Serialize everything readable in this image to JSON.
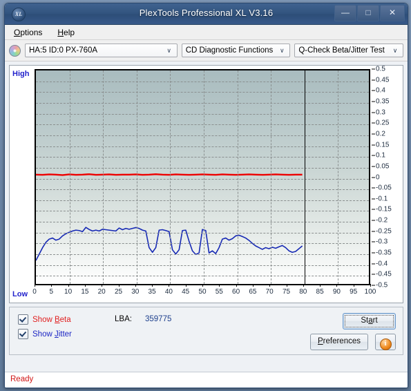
{
  "window": {
    "title": "PlexTools Professional XL V3.16",
    "app_icon": "XL",
    "minimize": "—",
    "maximize": "□",
    "close": "✕"
  },
  "menu": {
    "items": [
      {
        "prefix": "",
        "accel": "O",
        "suffix": "ptions"
      },
      {
        "prefix": "",
        "accel": "H",
        "suffix": "elp"
      }
    ]
  },
  "toolbar": {
    "disc_icon": "disc-icon",
    "device": "HA:5 ID:0  PX-760A",
    "function": "CD Diagnostic Functions",
    "test": "Q-Check Beta/Jitter Test",
    "arrow": "∨"
  },
  "chart_panel": {
    "label_high": "High",
    "label_low": "Low"
  },
  "controls": {
    "show_beta": {
      "label_prefix": "Show ",
      "accel": "B",
      "label_suffix": "eta",
      "checked": true,
      "color": "#e02020"
    },
    "show_jitter": {
      "label_prefix": "Show ",
      "accel": "J",
      "label_suffix": "itter",
      "checked": true,
      "color": "#1d27c4"
    },
    "lba_label": "LBA:",
    "lba_value": "359775",
    "start": {
      "prefix": "St",
      "accel": "a",
      "suffix": "rt"
    },
    "preferences": {
      "prefix": "",
      "accel": "P",
      "suffix": "references"
    },
    "info_glyph": "i"
  },
  "statusbar": {
    "text": "Ready"
  },
  "chart_data": {
    "type": "line",
    "title": "Q-Check Beta/Jitter Test",
    "xlabel": "",
    "ylabel": "",
    "xlim": [
      0,
      100
    ],
    "ylim": [
      -0.5,
      0.5
    ],
    "grid": true,
    "legend_position": "bottom-left",
    "xticks": [
      0,
      5,
      10,
      15,
      20,
      25,
      30,
      35,
      40,
      45,
      50,
      55,
      60,
      65,
      70,
      75,
      80,
      85,
      90,
      95,
      100
    ],
    "yticks": [
      0.5,
      0.45,
      0.4,
      0.35,
      0.3,
      0.25,
      0.2,
      0.15,
      0.1,
      0.05,
      0,
      -0.05,
      -0.1,
      -0.15,
      -0.2,
      -0.25,
      -0.3,
      -0.35,
      -0.4,
      -0.45,
      -0.5
    ],
    "axis_endpoint_labels": {
      "top": "High",
      "bottom": "Low"
    },
    "data_end_marker_x": 80,
    "series": [
      {
        "name": "Beta",
        "color": "#ee0000",
        "x": [
          0,
          2,
          4,
          6,
          8,
          10,
          12,
          14,
          16,
          18,
          20,
          22,
          24,
          26,
          28,
          30,
          32,
          34,
          36,
          38,
          40,
          42,
          44,
          46,
          48,
          50,
          52,
          54,
          56,
          58,
          60,
          62,
          64,
          66,
          68,
          70,
          72,
          74,
          76,
          78,
          80
        ],
        "values": [
          0.012,
          0.011,
          0.013,
          0.012,
          0.01,
          0.013,
          0.011,
          0.012,
          0.014,
          0.011,
          0.012,
          0.013,
          0.011,
          0.012,
          0.012,
          0.013,
          0.011,
          0.012,
          0.014,
          0.012,
          0.011,
          0.013,
          0.012,
          0.011,
          0.012,
          0.013,
          0.012,
          0.011,
          0.013,
          0.012,
          0.011,
          0.012,
          0.013,
          0.012,
          0.011,
          0.012,
          0.013,
          0.012,
          0.011,
          0.012,
          0.012
        ]
      },
      {
        "name": "Jitter",
        "color": "#1528b4",
        "x": [
          0,
          1,
          2,
          3,
          4,
          5,
          6,
          7,
          8,
          9,
          10,
          11,
          12,
          13,
          14,
          15,
          16,
          17,
          18,
          19,
          20,
          21,
          22,
          23,
          24,
          25,
          26,
          27,
          28,
          29,
          30,
          31,
          32,
          33,
          34,
          35,
          36,
          37,
          38,
          39,
          40,
          41,
          42,
          43,
          44,
          45,
          46,
          47,
          48,
          49,
          50,
          51,
          52,
          53,
          54,
          55,
          56,
          57,
          58,
          59,
          60,
          61,
          62,
          63,
          64,
          65,
          66,
          67,
          68,
          69,
          70,
          71,
          72,
          73,
          74,
          75,
          76,
          77,
          78,
          79,
          80
        ],
        "values": [
          -0.39,
          -0.36,
          -0.33,
          -0.305,
          -0.29,
          -0.285,
          -0.295,
          -0.29,
          -0.275,
          -0.265,
          -0.258,
          -0.252,
          -0.248,
          -0.25,
          -0.255,
          -0.235,
          -0.245,
          -0.252,
          -0.248,
          -0.252,
          -0.244,
          -0.246,
          -0.248,
          -0.25,
          -0.252,
          -0.238,
          -0.246,
          -0.24,
          -0.244,
          -0.24,
          -0.236,
          -0.24,
          -0.248,
          -0.252,
          -0.33,
          -0.352,
          -0.33,
          -0.248,
          -0.246,
          -0.25,
          -0.255,
          -0.34,
          -0.36,
          -0.34,
          -0.25,
          -0.248,
          -0.3,
          -0.345,
          -0.362,
          -0.355,
          -0.245,
          -0.25,
          -0.355,
          -0.345,
          -0.358,
          -0.33,
          -0.29,
          -0.285,
          -0.295,
          -0.288,
          -0.275,
          -0.272,
          -0.278,
          -0.285,
          -0.296,
          -0.31,
          -0.322,
          -0.33,
          -0.338,
          -0.33,
          -0.335,
          -0.328,
          -0.333,
          -0.326,
          -0.32,
          -0.33,
          -0.345,
          -0.352,
          -0.348,
          -0.335,
          -0.322
        ]
      }
    ]
  }
}
